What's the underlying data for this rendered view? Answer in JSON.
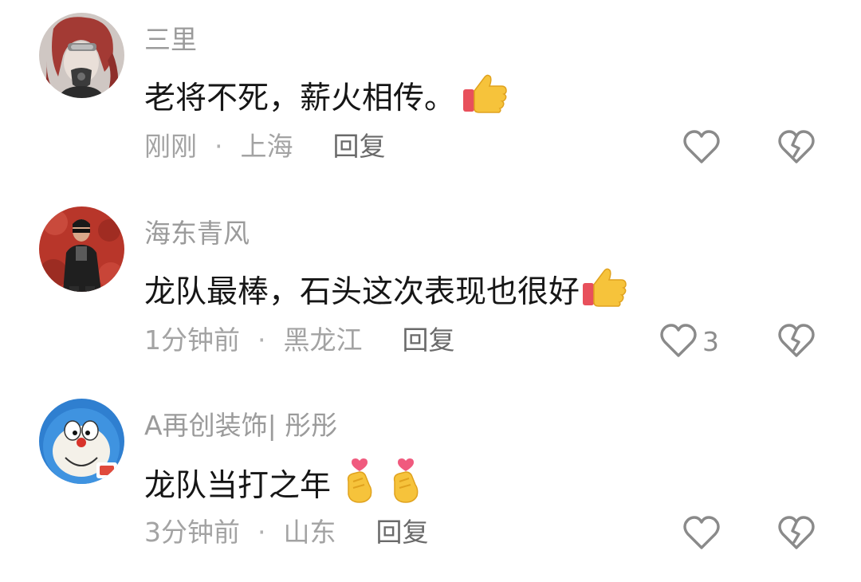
{
  "comments": [
    {
      "username": "三里",
      "content": "老将不死，薪火相传。",
      "emojis": [
        "thumbs-up"
      ],
      "time": "刚刚",
      "location": "上海",
      "reply_label": "回复",
      "like_count": "",
      "separator": "·"
    },
    {
      "username": "海东青风",
      "content": "龙队最棒，石头这次表现也很好",
      "emojis": [
        "thumbs-up"
      ],
      "time": "1分钟前",
      "location": "黑龙江",
      "reply_label": "回复",
      "like_count": "3",
      "separator": "·"
    },
    {
      "username": "A再创装饰| 彤彤",
      "content": "龙队当打之年",
      "emojis": [
        "finger-heart",
        "finger-heart"
      ],
      "time": "3分钟前",
      "location": "山东",
      "reply_label": "回复",
      "like_count": "",
      "separator": "·"
    }
  ],
  "colors": {
    "username": "#9b9b9b",
    "content": "#161616",
    "meta": "#a3a3a3",
    "reply": "#6a6a6a",
    "icon": "#8a8a8a"
  }
}
